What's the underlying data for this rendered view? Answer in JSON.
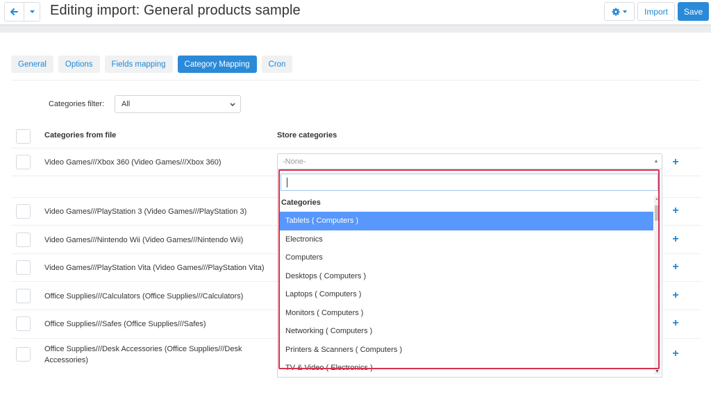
{
  "header": {
    "title": "Editing import: General products sample",
    "back_icon": "arrow-left-icon",
    "dropdown_icon": "caret-down-icon",
    "gear_icon": "gear-icon",
    "import_label": "Import",
    "save_label": "Save"
  },
  "tabs": [
    {
      "label": "General",
      "active": false
    },
    {
      "label": "Options",
      "active": false
    },
    {
      "label": "Fields mapping",
      "active": false
    },
    {
      "label": "Category Mapping",
      "active": true
    },
    {
      "label": "Cron",
      "active": false
    }
  ],
  "filter": {
    "label": "Categories filter:",
    "value": "All"
  },
  "table": {
    "headers": {
      "from_file": "Categories from file",
      "store": "Store categories"
    },
    "rows": [
      {
        "from_file": "Video Games///Xbox 360 (Video Games///Xbox 360)",
        "store": "-None-"
      },
      {
        "from_file": "Video Games///PlayStation 3 (Video Games///PlayStation 3)"
      },
      {
        "from_file": "Video Games///Nintendo Wii (Video Games///Nintendo Wii)"
      },
      {
        "from_file": "Video Games///PlayStation Vita (Video Games///PlayStation Vita)"
      },
      {
        "from_file": "Office Supplies///Calculators (Office Supplies///Calculators)"
      },
      {
        "from_file": "Office Supplies///Safes (Office Supplies///Safes)"
      },
      {
        "from_file": "Office Supplies///Desk Accessories (Office Supplies///Desk Accessories)"
      }
    ],
    "add_icon": "plus-icon"
  },
  "dropdown": {
    "search_value": "",
    "group_label": "Categories",
    "options": [
      "Tablets ( Computers )",
      "Electronics",
      "Computers",
      "Desktops ( Computers )",
      "Laptops ( Computers )",
      "Monitors ( Computers )",
      "Networking ( Computers )",
      "Printers & Scanners ( Computers )",
      "TV & Video ( Electronics )"
    ],
    "highlighted_index": 0
  },
  "colors": {
    "accent": "#2a8ad8",
    "highlight": "#5897fb",
    "annotation_border": "#d9304f"
  }
}
